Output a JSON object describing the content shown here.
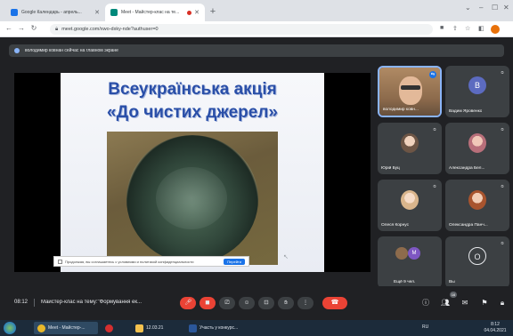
{
  "browser": {
    "tabs": [
      {
        "title": "Google Календарь - апрель...",
        "icon": "google-calendar-icon",
        "color": "#1a73e8"
      },
      {
        "title": "Meet - Майстер-клас на те...",
        "icon": "google-meet-icon",
        "color": "#00897b"
      }
    ],
    "new_tab_symbol": "+",
    "url": "meet.google.com/xwo-dxky-nde?authuser=0"
  },
  "meet": {
    "banner_text": "володимир ковнан сейчас на главном экране",
    "slide": {
      "title_line1": "Всеукраїнська акція",
      "title_line2": "«До чистих джерел»",
      "recaptcha_text": "Продолжая, вы соглашаетесь с условиями и политикой конфиденциальности",
      "recaptcha_button": "Перейти"
    },
    "participants": [
      {
        "name": "володимир ковн...",
        "type": "video",
        "self": true
      },
      {
        "name": "Вадим Яровенко",
        "type": "letter",
        "letter": "В",
        "avatar_color": "#5c6bc0"
      },
      {
        "name": "Юрій Буц",
        "type": "photo",
        "avatar_color": "#c9a48a"
      },
      {
        "name": "Александра Бел...",
        "type": "photo",
        "avatar_color": "#b86f7a"
      },
      {
        "name": "Олеся Корнус",
        "type": "photo",
        "avatar_color": "#d9b58c"
      },
      {
        "name": "Олександра Панч...",
        "type": "photo",
        "avatar_color": "#a8542e"
      },
      {
        "name": "Ещё 9 чел.",
        "type": "group",
        "letter": "М"
      },
      {
        "name": "Вы",
        "type": "letter",
        "letter": "О",
        "avatar_color": "#e8eaed"
      }
    ],
    "bottom": {
      "clock": "08:12",
      "meeting_title": "Майстер-клас на тему:\"Формування ек...",
      "participant_count": "16"
    },
    "colors": {
      "accent_red": "#ea4335",
      "control_bg": "#3c4043",
      "bg": "#202124"
    }
  },
  "taskbar": {
    "items": [
      {
        "label": "Meet - Майстер-...",
        "icon": "chrome-icon",
        "color": "#e8b82a"
      },
      {
        "label": "",
        "icon": "opera-icon",
        "color": "#d32f2f"
      },
      {
        "label": "12.03.21",
        "icon": "folder-icon",
        "color": "#f2c14e"
      },
      {
        "label": "Участь у конкурс...",
        "icon": "word-icon",
        "color": "#2b579a"
      }
    ],
    "tray": "RU",
    "time": "8:12",
    "date": "04.04.2021"
  }
}
